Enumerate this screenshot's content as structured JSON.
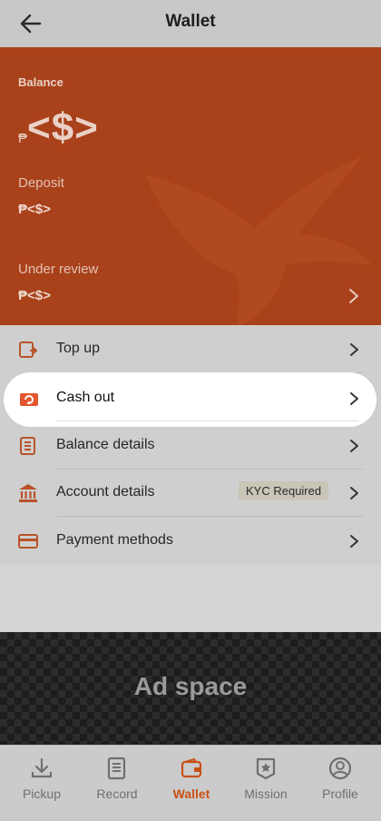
{
  "header": {
    "title": "Wallet",
    "back_icon": "arrow-left-icon"
  },
  "balance": {
    "label": "Balance",
    "currency_symbol": "₱",
    "amount": "<$>",
    "deposit_label": "Deposit",
    "deposit_amount": "₱<$>",
    "review_label": "Under review",
    "review_amount": "₱<$>"
  },
  "menu": {
    "items": [
      {
        "label": "Top up",
        "icon": "top-up-icon"
      },
      {
        "label": "Cash out",
        "icon": "cash-out-icon"
      },
      {
        "label": "Balance details",
        "icon": "document-list-icon"
      },
      {
        "label": "Account details",
        "icon": "bank-icon",
        "badge": "KYC Required"
      },
      {
        "label": "Payment methods",
        "icon": "credit-card-icon"
      }
    ]
  },
  "ad": {
    "text": "Ad space"
  },
  "tabbar": {
    "tabs": [
      {
        "label": "Pickup",
        "icon": "download-icon"
      },
      {
        "label": "Record",
        "icon": "record-icon"
      },
      {
        "label": "Wallet",
        "icon": "wallet-icon",
        "active": true
      },
      {
        "label": "Mission",
        "icon": "badge-star-icon"
      },
      {
        "label": "Profile",
        "icon": "profile-icon"
      }
    ]
  },
  "colors": {
    "accent": "#c85016",
    "card": "#a9411a",
    "kyc_badge": "#c9c5b7"
  }
}
